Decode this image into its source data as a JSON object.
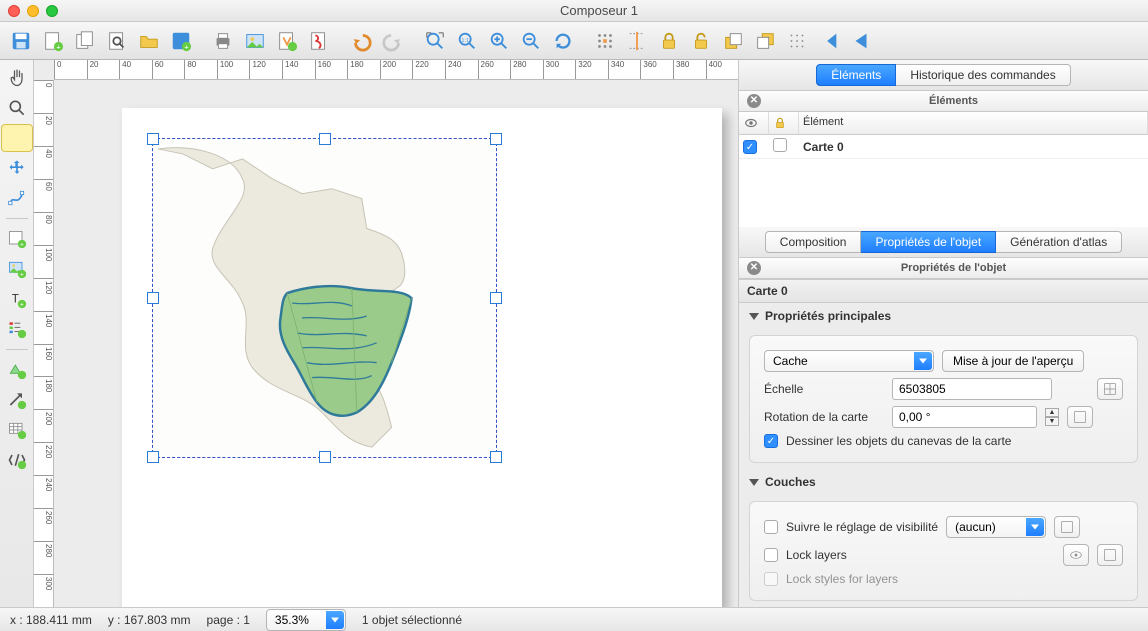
{
  "window": {
    "title": "Composeur 1"
  },
  "toolbar_icons": [
    "save",
    "new-composer",
    "duplicate",
    "manager",
    "open",
    "save-template",
    "print",
    "export-image",
    "export-svg",
    "export-pdf",
    "undo",
    "redo",
    "zoom-full",
    "zoom-100",
    "zoom-in",
    "zoom-out",
    "refresh",
    "target",
    "select-all",
    "lock",
    "unlock",
    "raise",
    "lower",
    "braille",
    "move-first",
    "move-prev"
  ],
  "left_tools": [
    "pan",
    "zoom",
    "select",
    "move-content",
    "node-edit",
    "",
    "add-map",
    "add-image",
    "add-label",
    "add-legend",
    "",
    "add-shape",
    "add-arrow",
    "add-table",
    "add-html"
  ],
  "panels": {
    "top_tabs": {
      "left": "Éléments",
      "right": "Historique des commandes"
    },
    "elements_title": "Éléments",
    "elements_header": "Élément",
    "elements": [
      {
        "visible": true,
        "locked": false,
        "name": "Carte 0"
      }
    ],
    "mid_tabs": {
      "a": "Composition",
      "b": "Propriétés de l'objet",
      "c": "Génération d'atlas"
    },
    "props_title": "Propriétés de l'objet",
    "item_name": "Carte 0",
    "main_props": {
      "title": "Propriétés principales",
      "mode": "Cache",
      "update_btn": "Mise à jour de l'aperçu",
      "scale_label": "Échelle",
      "scale_value": "6503805",
      "rotation_label": "Rotation de la carte",
      "rotation_value": "0,00 °",
      "draw_canvas": "Dessiner les objets du canevas de la carte",
      "draw_canvas_checked": true
    },
    "layers": {
      "title": "Couches",
      "follow_label": "Suivre le réglage de visibilité",
      "follow_value": "(aucun)",
      "lock_layers": "Lock layers",
      "lock_styles": "Lock styles for layers"
    }
  },
  "ruler_h": [
    "0",
    "20",
    "40",
    "60",
    "80",
    "100",
    "120",
    "140",
    "160",
    "180",
    "200",
    "220",
    "240",
    "260",
    "280",
    "300",
    "320",
    "340",
    "360",
    "380",
    "400"
  ],
  "ruler_v": [
    "0",
    "20",
    "40",
    "60",
    "80",
    "100",
    "120",
    "140",
    "160",
    "180",
    "200",
    "220",
    "240",
    "260",
    "280",
    "300"
  ],
  "status": {
    "x": "x : 188.411 mm",
    "y": "y : 167.803 mm",
    "page": "page : 1",
    "zoom": "35.3%",
    "selection": "1 objet sélectionné"
  }
}
